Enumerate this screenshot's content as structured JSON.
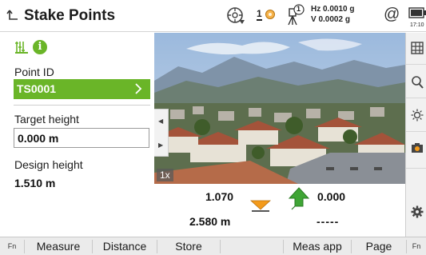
{
  "header": {
    "title": "Stake Points",
    "status": {
      "hz_text": "Hz 0.0010 g",
      "v_text": "V  0.0002 g",
      "prism_label": "1",
      "face_label": "1",
      "at_symbol": "@",
      "time": "17:10"
    }
  },
  "left": {
    "tabs": [
      {
        "icon": "stakeout-rows-icon",
        "selected": true
      },
      {
        "icon": "info-icon",
        "glyph": "i"
      }
    ],
    "point_id": {
      "label": "Point ID",
      "value": "TS0001"
    },
    "target_height": {
      "label": "Target height",
      "value": "0.000 m"
    },
    "design_height": {
      "label": "Design height",
      "value": "1.510 m"
    }
  },
  "camera": {
    "zoom": "1x"
  },
  "readouts": {
    "value_left_top": "1.070",
    "value_right_top": "0.000",
    "value_left_bottom": "2.580 m",
    "value_right_bottom": "-----"
  },
  "softkeys": {
    "fn_left": "Fn",
    "measure": "Measure",
    "distance": "Distance",
    "store": "Store",
    "meas_app": "Meas app",
    "page": "Page",
    "fn_right": "Fn"
  },
  "colors": {
    "accent_green": "#6ab528",
    "arrow_orange": "#f39a1b",
    "arrow_green": "#3fa535"
  }
}
